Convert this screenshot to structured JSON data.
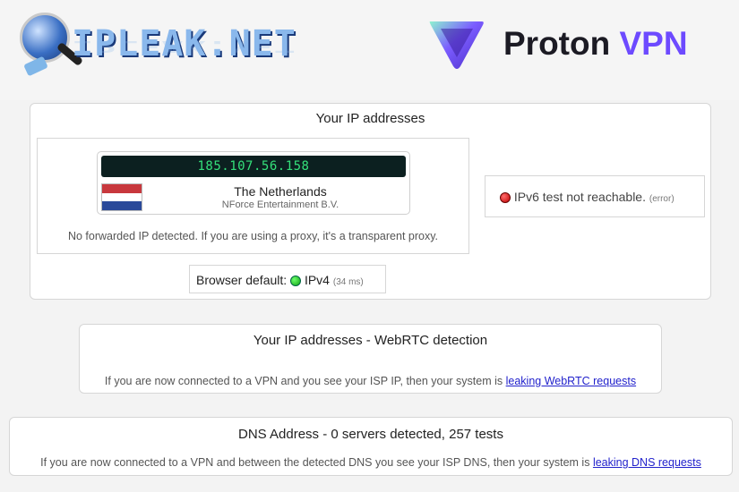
{
  "header": {
    "left_logo_text": "IPLEAK.NET",
    "right_logo_brand": "Proton",
    "right_logo_product": "VPN",
    "colors": {
      "proton_purple": "#6d4aff",
      "ipleak_blue": "#8ab8ec"
    }
  },
  "ip_panel": {
    "title": "Your IP addresses",
    "ip": "185.107.56.158",
    "country": "The Netherlands",
    "isp": "NForce Entertainment B.V.",
    "forward_note": "No forwarded IP detected. If you are using a proxy, it's a transparent proxy.",
    "ipv6_text": "IPv6 test not reachable.",
    "ipv6_note": "(error)",
    "browser_default_label": "Browser default:",
    "browser_default_value": "IPv4",
    "browser_default_time": "(34 ms)"
  },
  "webrtc_panel": {
    "title": "Your IP addresses - WebRTC detection",
    "text": "If you are now connected to a VPN and you see your ISP IP, then your system is",
    "link": "leaking WebRTC requests"
  },
  "dns_panel": {
    "title": "DNS Address - 0 servers detected, 257 tests",
    "text": "If you are now connected to a VPN and between the detected DNS you see your ISP DNS, then your system is",
    "link": "leaking DNS requests"
  }
}
